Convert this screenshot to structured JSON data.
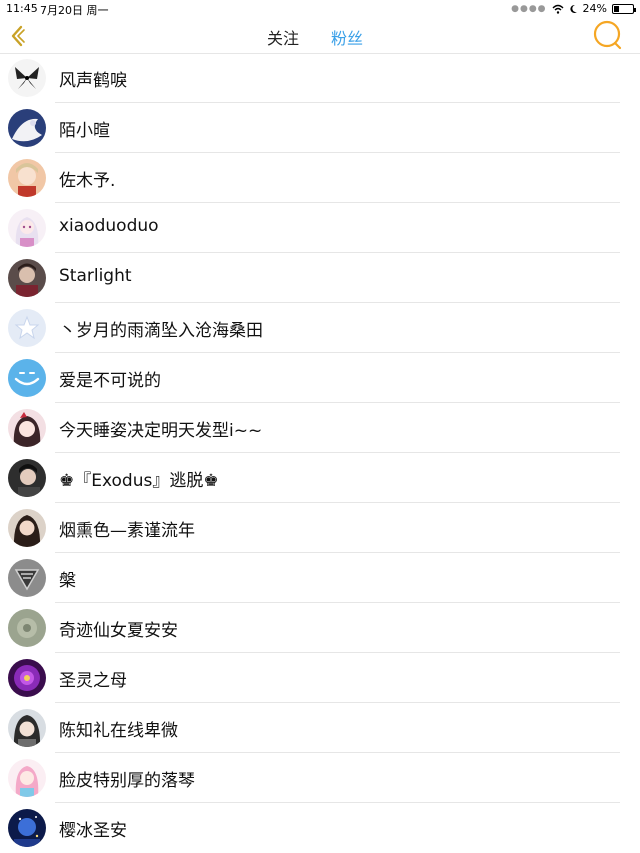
{
  "status": {
    "time": "11:45",
    "date": "7月20日 周一",
    "battery": "24%"
  },
  "nav": {
    "tab_follow": "关注",
    "tab_fans": "粉丝",
    "active_color": "#3aa0e8",
    "accent_color": "#f5a623"
  },
  "fans": [
    {
      "name": "风声鹤唳"
    },
    {
      "name": "陌小暄"
    },
    {
      "name": "佐木予."
    },
    {
      "name": "xiaoduoduo"
    },
    {
      "name": "Starlight"
    },
    {
      "name": "丶岁月的雨滴坠入沧海桑田"
    },
    {
      "name": "爱是不可说的"
    },
    {
      "name": "今天睡姿决定明天发型i~~"
    },
    {
      "name": "♚『Exodus』逃脱♚"
    },
    {
      "name": "烟熏色—素谨流年"
    },
    {
      "name": "槃"
    },
    {
      "name": "奇迹仙女夏安安"
    },
    {
      "name": "圣灵之母"
    },
    {
      "name": "陈知礼在线卑微"
    },
    {
      "name": "脸皮特别厚的落琴"
    },
    {
      "name": "樱冰圣安"
    }
  ]
}
